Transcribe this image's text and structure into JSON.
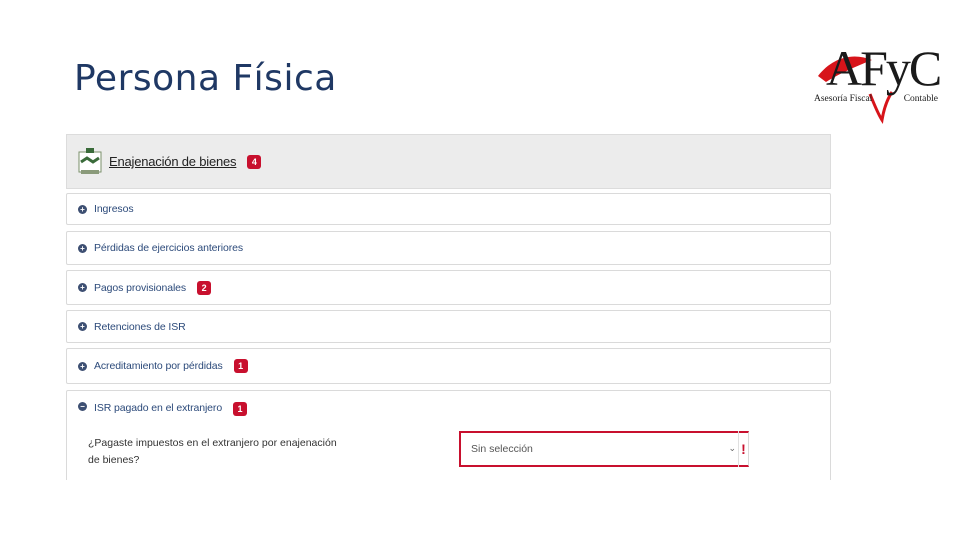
{
  "slide": {
    "title": "Persona Física"
  },
  "logo": {
    "letters": "AFyC",
    "caption_left": "Asesoría Fiscal",
    "caption_right": "Contable"
  },
  "section": {
    "title": "Enajenación de bienes",
    "badge": "4"
  },
  "rows": [
    {
      "label": "Ingresos",
      "badge": ""
    },
    {
      "label": "Pérdidas de ejercicios anteriores",
      "badge": ""
    },
    {
      "label": "Pagos provisionales",
      "badge": "2"
    },
    {
      "label": "Retenciones de ISR",
      "badge": ""
    },
    {
      "label": "Acreditamiento por pérdidas",
      "badge": "1"
    },
    {
      "label": "ISR pagado en el extranjero",
      "badge": "1"
    }
  ],
  "question": {
    "label": "¿Pagaste impuestos en el extranjero por enajenación de bienes?",
    "select_value": "Sin selección",
    "error_mark": "!"
  },
  "colors": {
    "title": "#1f3864",
    "badge": "#c8102e",
    "row_label": "#2c4a7a",
    "header_bg": "#ececec"
  }
}
